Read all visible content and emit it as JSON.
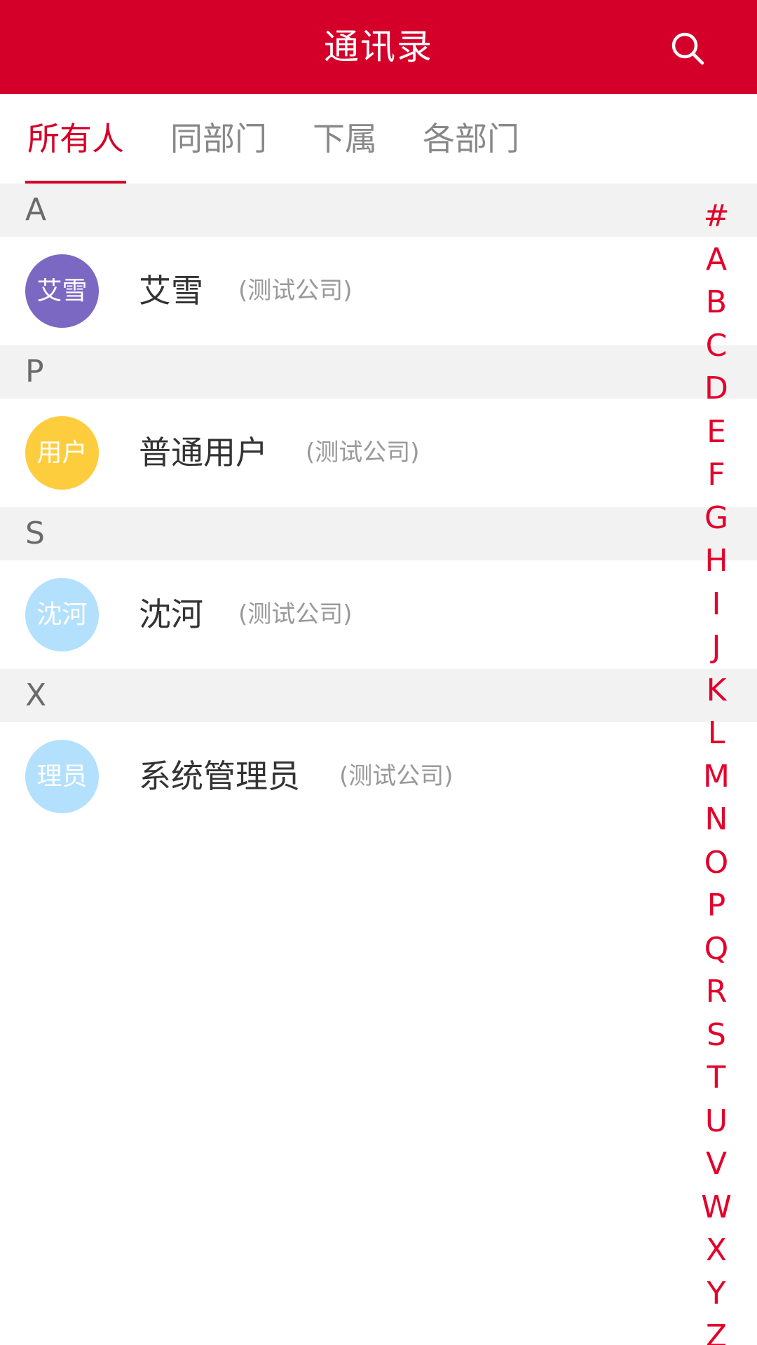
{
  "header": {
    "title": "通讯录",
    "background": "#d50029",
    "search_icon": "search-icon"
  },
  "tabs": [
    {
      "label": "所有人",
      "active": true
    },
    {
      "label": "同部门",
      "active": false
    },
    {
      "label": "下属",
      "active": false
    },
    {
      "label": "各部门",
      "active": false
    }
  ],
  "sections": [
    {
      "letter": "A",
      "contacts": [
        {
          "avatar_text": "艾雪",
          "avatar_color": "#7b68c2",
          "name": "艾雪",
          "company": "(测试公司)"
        }
      ]
    },
    {
      "letter": "P",
      "contacts": [
        {
          "avatar_text": "用户",
          "avatar_color": "#fdcd3e",
          "name": "普通用户",
          "company": "(测试公司)"
        }
      ]
    },
    {
      "letter": "S",
      "contacts": [
        {
          "avatar_text": "沈河",
          "avatar_color": "#b3e0fc",
          "name": "沈河",
          "company": "(测试公司)"
        }
      ]
    },
    {
      "letter": "X",
      "contacts": [
        {
          "avatar_text": "理员",
          "avatar_color": "#b3e0fc",
          "name": "系统管理员",
          "company": "(测试公司)"
        }
      ]
    }
  ],
  "index": [
    "#",
    "A",
    "B",
    "C",
    "D",
    "E",
    "F",
    "G",
    "H",
    "I",
    "J",
    "K",
    "L",
    "M",
    "N",
    "O",
    "P",
    "Q",
    "R",
    "S",
    "T",
    "U",
    "V",
    "W",
    "X",
    "Y",
    "Z"
  ],
  "colors": {
    "accent": "#d50029",
    "index_letter": "#e3002b",
    "section_background": "#f2f2f2"
  }
}
